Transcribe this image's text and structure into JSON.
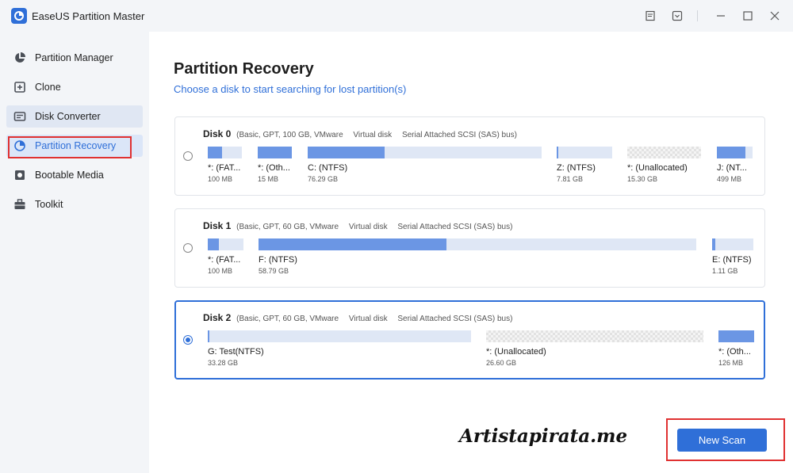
{
  "app": {
    "title": "EaseUS Partition Master"
  },
  "sidebar": {
    "items": [
      {
        "label": "Partition Manager",
        "icon": "pie-chart-icon"
      },
      {
        "label": "Clone",
        "icon": "clone-icon"
      },
      {
        "label": "Disk Converter",
        "icon": "disk-converter-icon"
      },
      {
        "label": "Partition Recovery",
        "icon": "partition-recovery-icon"
      },
      {
        "label": "Bootable Media",
        "icon": "bootable-media-icon"
      },
      {
        "label": "Toolkit",
        "icon": "toolkit-icon"
      }
    ]
  },
  "main": {
    "title": "Partition Recovery",
    "subtitle": "Choose a disk to start searching for lost partition(s)",
    "disks": [
      {
        "name": "Disk 0",
        "info": [
          "(Basic, GPT, 100 GB, VMware",
          "Virtual disk",
          "Serial Attached SCSI (SAS) bus)"
        ],
        "selected": false,
        "partitions": [
          {
            "label": "*: (FAT...",
            "size": "100 MB",
            "fill": 0.42
          },
          {
            "label": "*: (Oth...",
            "size": "15 MB",
            "fill": 1.0
          },
          {
            "label": "C: (NTFS)",
            "size": "76.29 GB",
            "fill": 0.33
          },
          {
            "label": "Z: (NTFS)",
            "size": "7.81 GB",
            "fill": 0.02
          },
          {
            "label": "*: (Unallocated)",
            "size": "15.30 GB",
            "fill": 0
          },
          {
            "label": "J: (NT...",
            "size": "499 MB",
            "fill": 0.8
          }
        ]
      },
      {
        "name": "Disk 1",
        "info": [
          "(Basic, GPT, 60 GB, VMware",
          "Virtual disk",
          "Serial Attached SCSI (SAS) bus)"
        ],
        "selected": false,
        "partitions": [
          {
            "label": "*: (FAT...",
            "size": "100 MB",
            "fill": 0.3
          },
          {
            "label": "F: (NTFS)",
            "size": "58.79 GB",
            "fill": 0.43
          },
          {
            "label": "E: (NTFS)",
            "size": "1.11 GB",
            "fill": 0.08
          }
        ]
      },
      {
        "name": "Disk 2",
        "info": [
          "(Basic, GPT, 60 GB, VMware",
          "Virtual disk",
          "Serial Attached SCSI (SAS) bus)"
        ],
        "selected": true,
        "partitions": [
          {
            "label": "G: Test(NTFS)",
            "size": "33.28 GB",
            "fill": 0.005
          },
          {
            "label": "*: (Unallocated)",
            "size": "26.60 GB",
            "fill": 0
          },
          {
            "label": "*: (Oth...",
            "size": "126 MB",
            "fill": 1.0
          }
        ]
      }
    ],
    "new_scan_label": "New Scan"
  },
  "watermark": "Artistapirata.me",
  "colors": {
    "accent": "#2f6fd8",
    "highlight": "#e03131",
    "partition_fill": "#6b96e4",
    "partition_track": "#dfe7f5"
  }
}
